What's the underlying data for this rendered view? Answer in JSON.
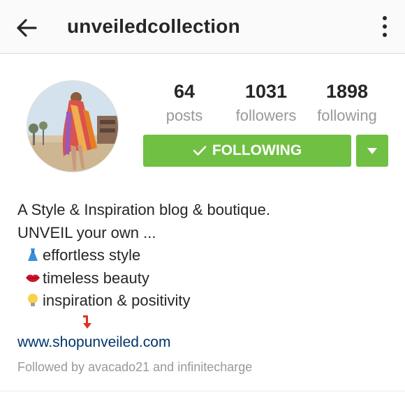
{
  "header": {
    "username": "unveiledcollection",
    "back_icon": "arrow-left-icon",
    "menu_icon": "more-vertical-icon"
  },
  "profile": {
    "avatar_icon": "profile-photo"
  },
  "stats": [
    {
      "value": "64",
      "label": "posts"
    },
    {
      "value": "1031",
      "label": "followers"
    },
    {
      "value": "1898",
      "label": "following"
    }
  ],
  "actions": {
    "follow_label": "FOLLOWING",
    "follow_icon": "checkmark-icon",
    "dropdown_icon": "caret-down-icon",
    "accent_color": "#70c043"
  },
  "bio": {
    "line1": "A Style & Inspiration blog & boutique.",
    "line2": "UNVEIL your own ...",
    "items": [
      {
        "icon": "dress-icon",
        "text": "effortless style"
      },
      {
        "icon": "lips-icon",
        "text": "timeless beauty"
      },
      {
        "icon": "light-bulb-icon",
        "text": "inspiration & positivity"
      }
    ],
    "arrow_icon": "arrow-down-red-icon"
  },
  "website": "www.shopunveiled.com",
  "followed_by": {
    "prefix": "Followed by",
    "user1": "avacado21",
    "conjunction": "and",
    "user2": "infinitecharge"
  }
}
